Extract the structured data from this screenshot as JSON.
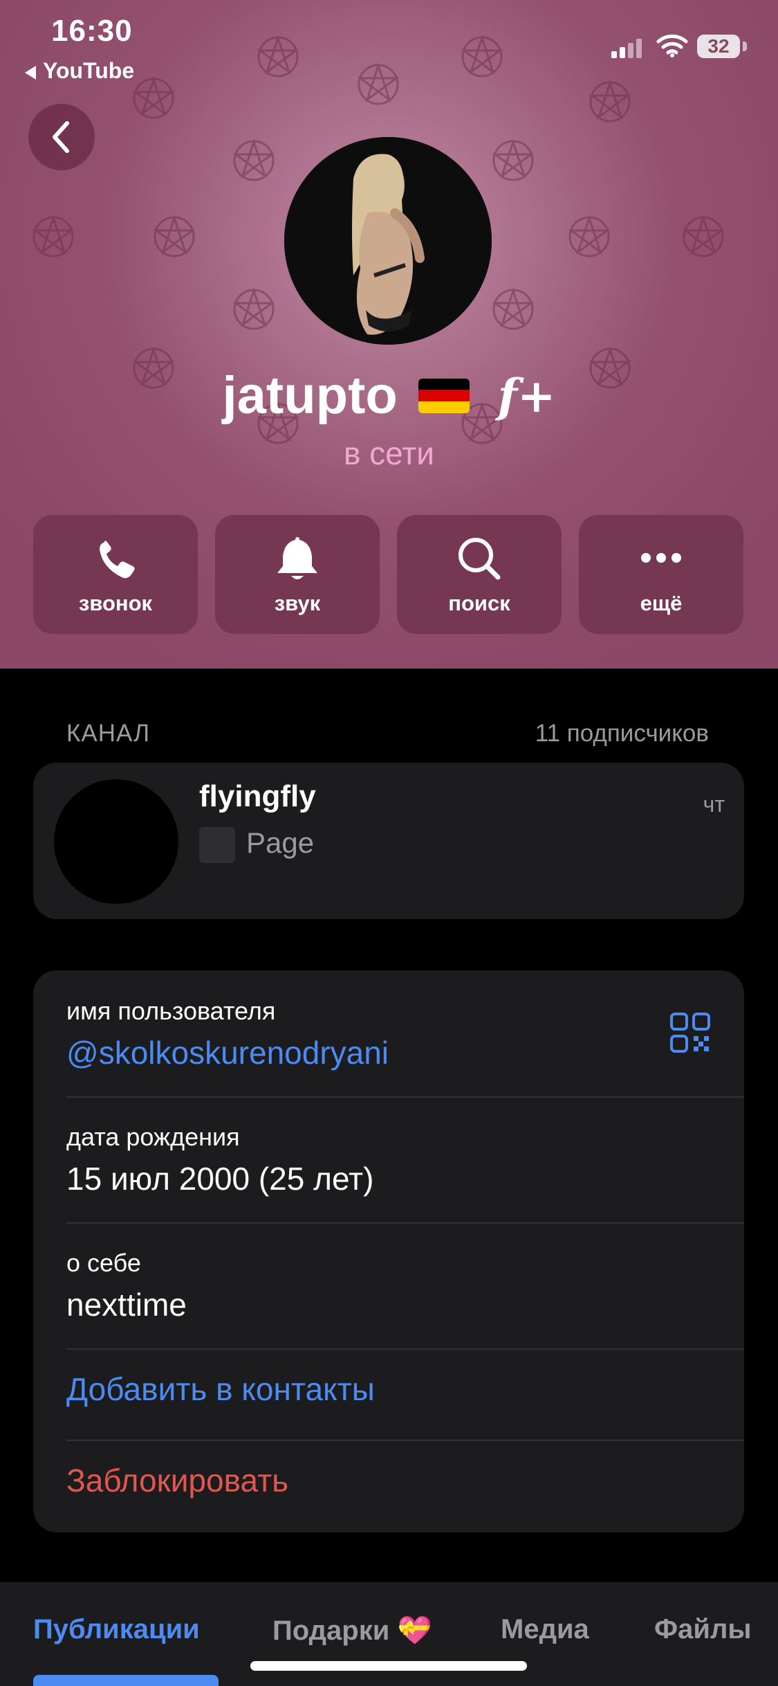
{
  "status_bar": {
    "time": "16:30",
    "back_app": "YouTube",
    "battery": "32"
  },
  "profile": {
    "name": "jatupto",
    "premium_badge": "f+",
    "status": "в сети"
  },
  "actions": [
    {
      "icon": "phone-icon",
      "label": "звонок"
    },
    {
      "icon": "bell-icon",
      "label": "звук"
    },
    {
      "icon": "search-icon",
      "label": "поиск"
    },
    {
      "icon": "more-icon",
      "label": "ещё"
    }
  ],
  "channel_section": {
    "title": "КАНАЛ",
    "subscribers": "11 подписчиков"
  },
  "channel": {
    "name": "flyingfly",
    "last_message": "Page",
    "day": "чт"
  },
  "info": {
    "username_label": "имя пользователя",
    "username": "@skolkoskurenodryani",
    "birthday_label": "дата рождения",
    "birthday": "15 июл 2000 (25 лет)",
    "bio_label": "о себе",
    "bio": "nexttime",
    "add_contact": "Добавить в контакты",
    "block": "Заблокировать"
  },
  "tabs": [
    {
      "label": "Публикации",
      "active": true
    },
    {
      "label": "Подарки 💝",
      "active": false
    },
    {
      "label": "Медиа",
      "active": false
    },
    {
      "label": "Файлы",
      "active": false
    }
  ],
  "colors": {
    "header": "#8a4866",
    "accent": "#4c8cf2",
    "danger": "#e0574f",
    "online": "#f1a9cd"
  }
}
